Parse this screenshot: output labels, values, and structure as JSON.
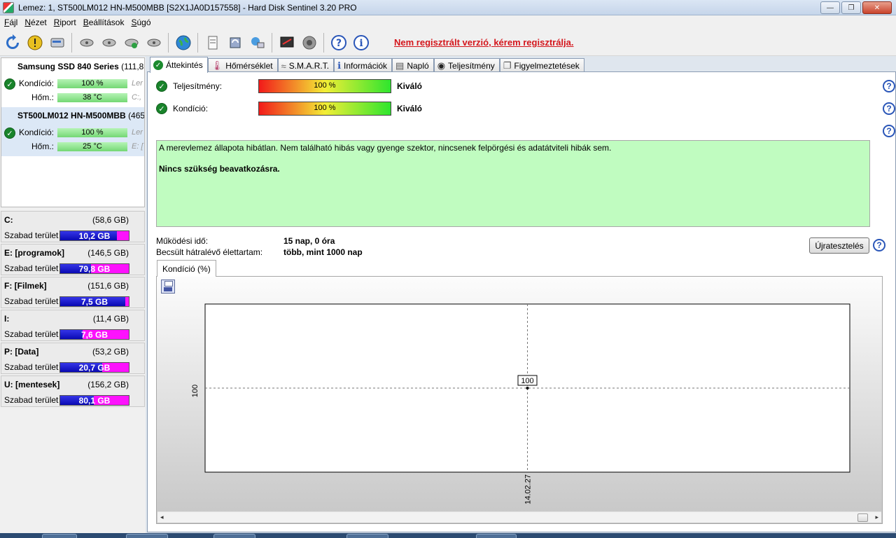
{
  "window": {
    "title": "Lemez: 1, ST500LM012 HN-M500MBB [S2X1JA0D157558]  -  Hard Disk Sentinel 3.20 PRO",
    "controls": {
      "minimize": "—",
      "maximize": "❐",
      "close": "✕"
    }
  },
  "menu": [
    {
      "label": "Fájl",
      "accel": "F",
      "rest": "ájl"
    },
    {
      "label": "Nézet",
      "accel": "N",
      "rest": "ézet"
    },
    {
      "label": "Riport",
      "accel": "R",
      "rest": "iport"
    },
    {
      "label": "Beállítások",
      "accel": "B",
      "rest": "eállítások"
    },
    {
      "label": "Súgó",
      "accel": "S",
      "rest": "úgó"
    }
  ],
  "toolbar": {
    "registration_notice": "Nem regisztrált verzió, kérem regisztrálja.",
    "icons": [
      "refresh-icon",
      "alert-icon",
      "disk-icon",
      "usb-icon",
      "usb-icon",
      "usb-icon",
      "usb-icon",
      "globe-icon",
      "report-icon",
      "sync-icon",
      "network-icon",
      "benchmark-icon",
      "speaker-icon",
      "help-icon",
      "info-icon"
    ]
  },
  "disks": [
    {
      "name": "Samsung SSD 840 Series",
      "size_suffix": "(111,8 G",
      "condition_label": "Kondíció:",
      "condition": "100 %",
      "temp_label": "Hőm.:",
      "temp": "38 °C",
      "extra1": "Ler",
      "extra2": "C:,",
      "selected": false
    },
    {
      "name": "ST500LM012 HN-M500MBB",
      "size_suffix": "(465",
      "condition_label": "Kondíció:",
      "condition": "100 %",
      "temp_label": "Hőm.:",
      "temp": "25 °C",
      "extra1": "Ler",
      "extra2": "E: [",
      "selected": true
    }
  ],
  "partitions": [
    {
      "name": "C:",
      "size": "(58,6 GB)",
      "free_label": "Szabad terület",
      "free": "10,2 GB",
      "used_fraction": 0.83
    },
    {
      "name": "E: [programok]",
      "size": "(146,5 GB)",
      "free_label": "Szabad terület",
      "free": "79,8 GB",
      "used_fraction": 0.45
    },
    {
      "name": "F: [Filmek]",
      "size": "(151,6 GB)",
      "free_label": "Szabad terület",
      "free": "7,5 GB",
      "used_fraction": 0.95
    },
    {
      "name": "I:",
      "size": "(11,4 GB)",
      "free_label": "Szabad terület",
      "free": "7,6 GB",
      "used_fraction": 0.33
    },
    {
      "name": "P: [Data]",
      "size": "(53,2 GB)",
      "free_label": "Szabad terület",
      "free": "20,7 GB",
      "used_fraction": 0.61
    },
    {
      "name": "U: [mentesek]",
      "size": "(156,2 GB)",
      "free_label": "Szabad terület",
      "free": "80,1 GB",
      "used_fraction": 0.49
    }
  ],
  "tabs": [
    {
      "label": "Áttekintés",
      "icon": "check-icon",
      "active": true
    },
    {
      "label": "Hőmérséklet",
      "icon": "thermometer-icon",
      "active": false
    },
    {
      "label": "S.M.A.R.T.",
      "icon": "smart-icon",
      "active": false
    },
    {
      "label": "Információk",
      "icon": "info-icon",
      "active": false
    },
    {
      "label": "Napló",
      "icon": "log-icon",
      "active": false
    },
    {
      "label": "Teljesítmény",
      "icon": "performance-icon",
      "active": false
    },
    {
      "label": "Figyelmeztetések",
      "icon": "alerts-icon",
      "active": false
    }
  ],
  "overview": {
    "performance_label": "Teljesítmény:",
    "performance_value": "100 %",
    "performance_status": "Kiváló",
    "condition_label": "Kondíció:",
    "condition_value": "100 %",
    "condition_status": "Kiváló",
    "status_text": "A merevlemez állapota hibátlan. Nem található hibás vagy gyenge szektor, nincsenek felpörgési és adatátviteli hibák sem.",
    "recommendation": "Nincs szükség beavatkozásra.",
    "uptime_label": "Működési idő:",
    "uptime_value": "15 nap, 0 óra",
    "lifetime_label": "Becsült hátralévő élettartam:",
    "lifetime_value": "több, mint 1000 nap",
    "retest_button": "Újratesztelés",
    "help_glyph": "?"
  },
  "chart_tab": {
    "label": "Kondíció  (%)"
  },
  "chart_data": {
    "type": "line",
    "title": "",
    "xlabel": "",
    "ylabel": "",
    "x": [
      "14.02.27"
    ],
    "series": [
      {
        "values": [
          100
        ]
      }
    ],
    "y_ticks": [
      "100"
    ],
    "x_ticks": [
      "14.02.27"
    ],
    "point_labels": [
      "100"
    ],
    "grid": true
  },
  "colors": {
    "status_bg": "#c0fcc0",
    "registration_red": "#d4161c",
    "ok_green": "#19842b",
    "partition_used": "#0a0ab3",
    "partition_free": "#fd12fd"
  }
}
